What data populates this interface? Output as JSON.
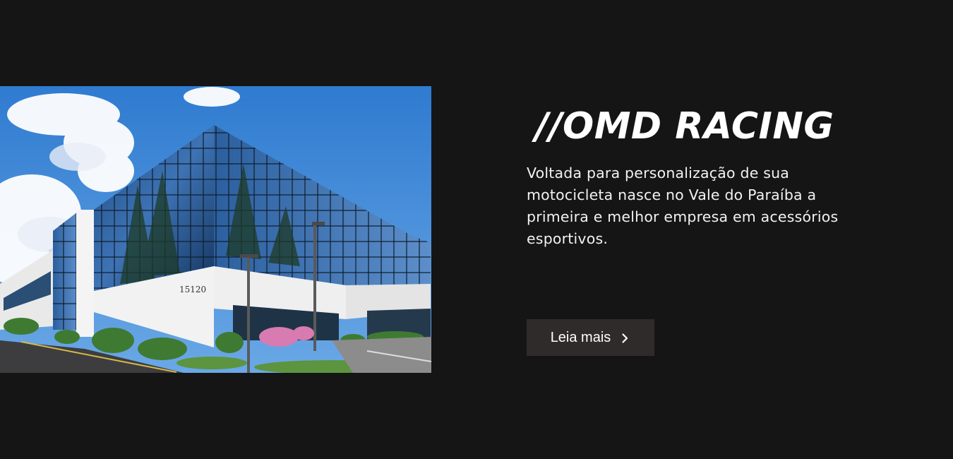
{
  "about": {
    "title": "//OMD RACING",
    "description": "Voltada para personalização de sua motocicleta nasce no Vale do Paraíba a primeira e melhor empresa em acessórios esportivos.",
    "button_label": "Leia mais",
    "button_icon": "chevron-right-icon"
  },
  "photo": {
    "alt": "Edifício comercial com fachada de vidro",
    "building_number": "15120"
  },
  "colors": {
    "background": "#151515",
    "button_background": "#302b2b",
    "text": "#ffffff"
  }
}
